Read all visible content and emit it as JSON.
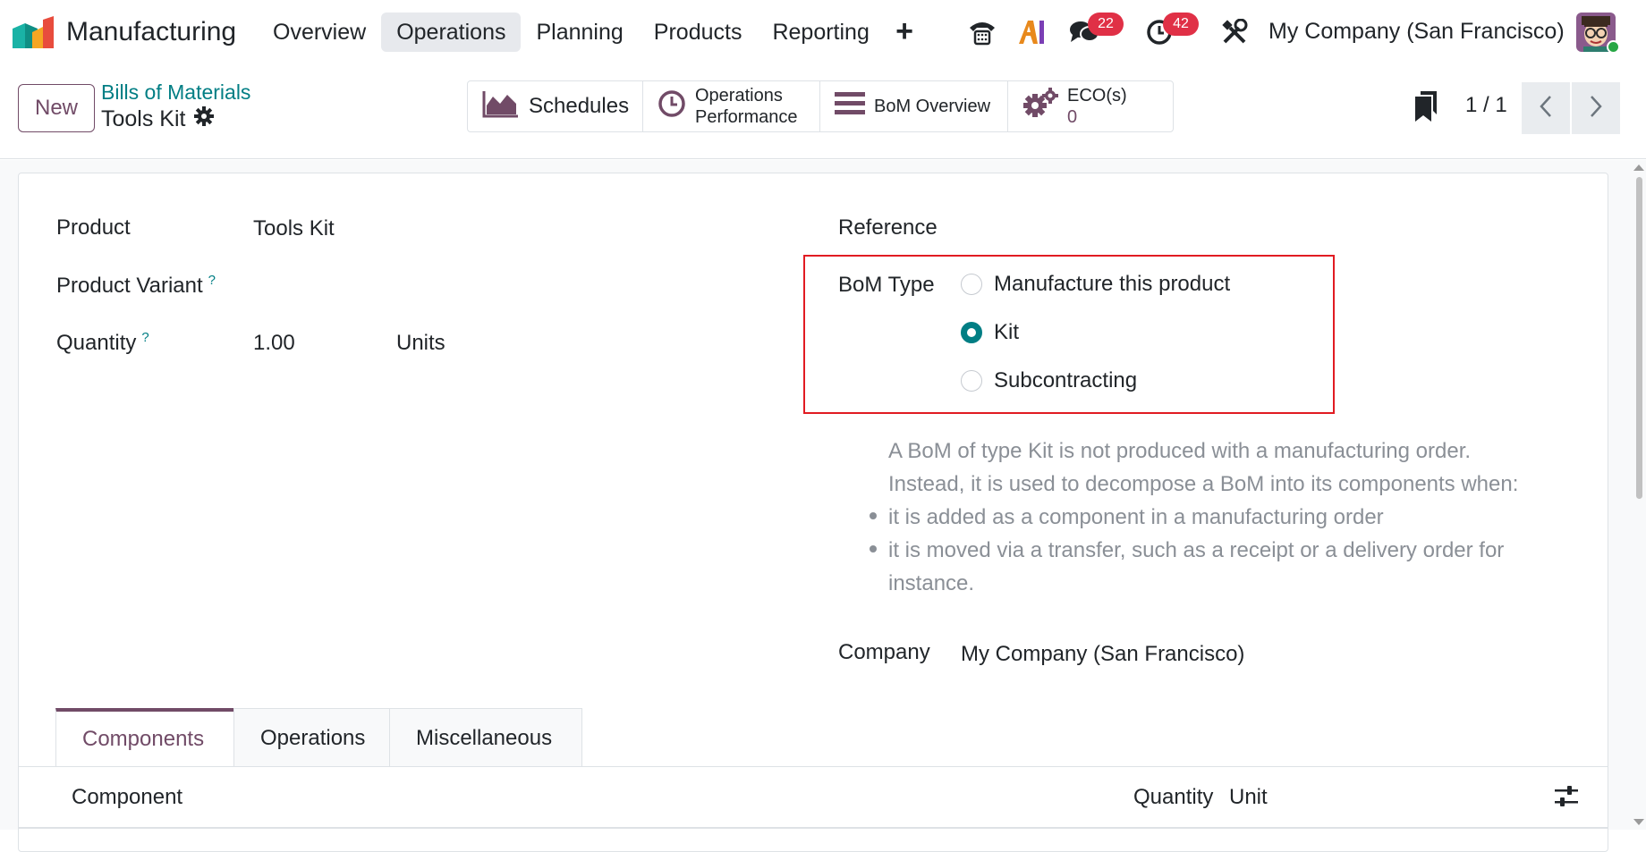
{
  "navbar": {
    "app_name": "Manufacturing",
    "menu": [
      {
        "label": "Overview",
        "active": false
      },
      {
        "label": "Operations",
        "active": true
      },
      {
        "label": "Planning",
        "active": false
      },
      {
        "label": "Products",
        "active": false
      },
      {
        "label": "Reporting",
        "active": false
      }
    ],
    "icons": [
      "plus-icon",
      "phone-icon",
      "ai-icon",
      "chat-icon",
      "activity-clock-icon",
      "tools-icon"
    ],
    "chat_badge": "22",
    "activity_badge": "42",
    "company": "My Company (San Francisco)"
  },
  "control_panel": {
    "new_label": "New",
    "breadcrumb": "Bills of Materials",
    "record_title": "Tools Kit",
    "smart_buttons": {
      "schedules": "Schedules",
      "operations_line1": "Operations",
      "operations_line2": "Performance",
      "bom_overview": "BoM Overview",
      "eco_label": "ECO(s)",
      "eco_count": "0"
    },
    "pager": "1 / 1"
  },
  "form": {
    "product_label": "Product",
    "product_value": "Tools Kit",
    "variant_label": "Product Variant",
    "quantity_label": "Quantity",
    "quantity_value": "1.00",
    "quantity_unit": "Units",
    "help_mark": "?",
    "reference_label": "Reference",
    "bom_type_label": "BoM Type",
    "bom_type_options": [
      {
        "label": "Manufacture this product",
        "checked": false
      },
      {
        "label": "Kit",
        "checked": true
      },
      {
        "label": "Subcontracting",
        "checked": false
      }
    ],
    "note_line1": "A BoM of type Kit is not produced with a manufacturing order.",
    "note_line2": "Instead, it is used to decompose a BoM into its components when:",
    "note_bullet1": "it is added as a component in a manufacturing order",
    "note_bullet2": "it is moved via a transfer, such as a receipt or a delivery order for instance.",
    "company_label": "Company",
    "company_value": "My Company (San Francisco)"
  },
  "tabs": [
    {
      "label": "Components",
      "active": true
    },
    {
      "label": "Operations",
      "active": false
    },
    {
      "label": "Miscellaneous",
      "active": false
    }
  ],
  "table": {
    "headers": {
      "component": "Component",
      "quantity": "Quantity",
      "unit": "Unit"
    }
  },
  "colors": {
    "brand": "#714b67",
    "accent": "#017e84",
    "badge": "#e03046",
    "highlight_border": "#e11b22"
  }
}
